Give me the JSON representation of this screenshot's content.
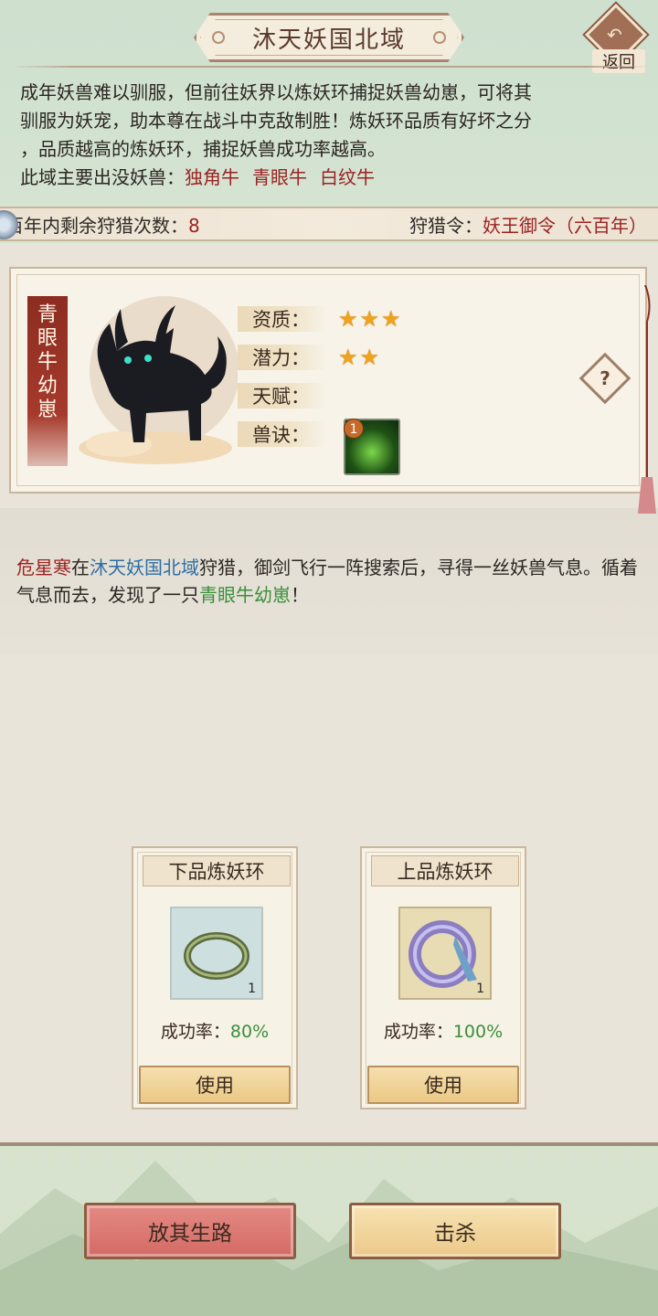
{
  "header": {
    "title": "沐天妖国北域",
    "back_label": "返回"
  },
  "description": {
    "lines": [
      "成年妖兽难以驯服，但前往妖界以炼妖环捕捉妖兽幼崽，可将其",
      "驯服为妖宠，助本尊在战斗中克敌制胜！炼妖环品质有好坏之分",
      "，品质越高的炼妖环，捕捉妖兽成功率越高。"
    ],
    "monsters_label": "此域主要出没妖兽：",
    "monsters": [
      "独角牛",
      "青眼牛",
      "白纹牛"
    ]
  },
  "hunt_bar": {
    "remaining_label": "百年内剩余狩猎次数：",
    "remaining_value": "8",
    "token_label": "狩猎令：",
    "token_value": "妖王御令（六百年）"
  },
  "monster": {
    "name_chars": [
      "青",
      "眼",
      "牛",
      "幼",
      "崽"
    ],
    "stats": {
      "quality_label": "资质：",
      "quality_stars": 3,
      "potential_label": "潜力：",
      "potential_stars": 2,
      "talent_label": "天赋：",
      "skill_label": "兽诀："
    },
    "skill_level": "1",
    "help_symbol": "?"
  },
  "story": {
    "hero": "危星寒",
    "t1": "在",
    "place": "沐天妖国北域",
    "t2": "狩猎，御剑飞行一阵搜索后，寻得一丝妖兽气息。循着气息而去，发现了一只",
    "beast": "青眼牛幼崽",
    "t3": "！"
  },
  "rings": [
    {
      "title": "下品炼妖环",
      "count": "1",
      "rate_label": "成功率：",
      "rate": "80%",
      "use_label": "使用"
    },
    {
      "title": "上品炼妖环",
      "count": "1",
      "rate_label": "成功率：",
      "rate": "100%",
      "use_label": "使用"
    }
  ],
  "actions": {
    "spare_label": "放其生路",
    "kill_label": "击杀"
  },
  "colors": {
    "accent_red": "#9b2222",
    "place_blue": "#2d6fa6",
    "success_green": "#3a8f3a",
    "star_gold": "#f0a21c"
  }
}
